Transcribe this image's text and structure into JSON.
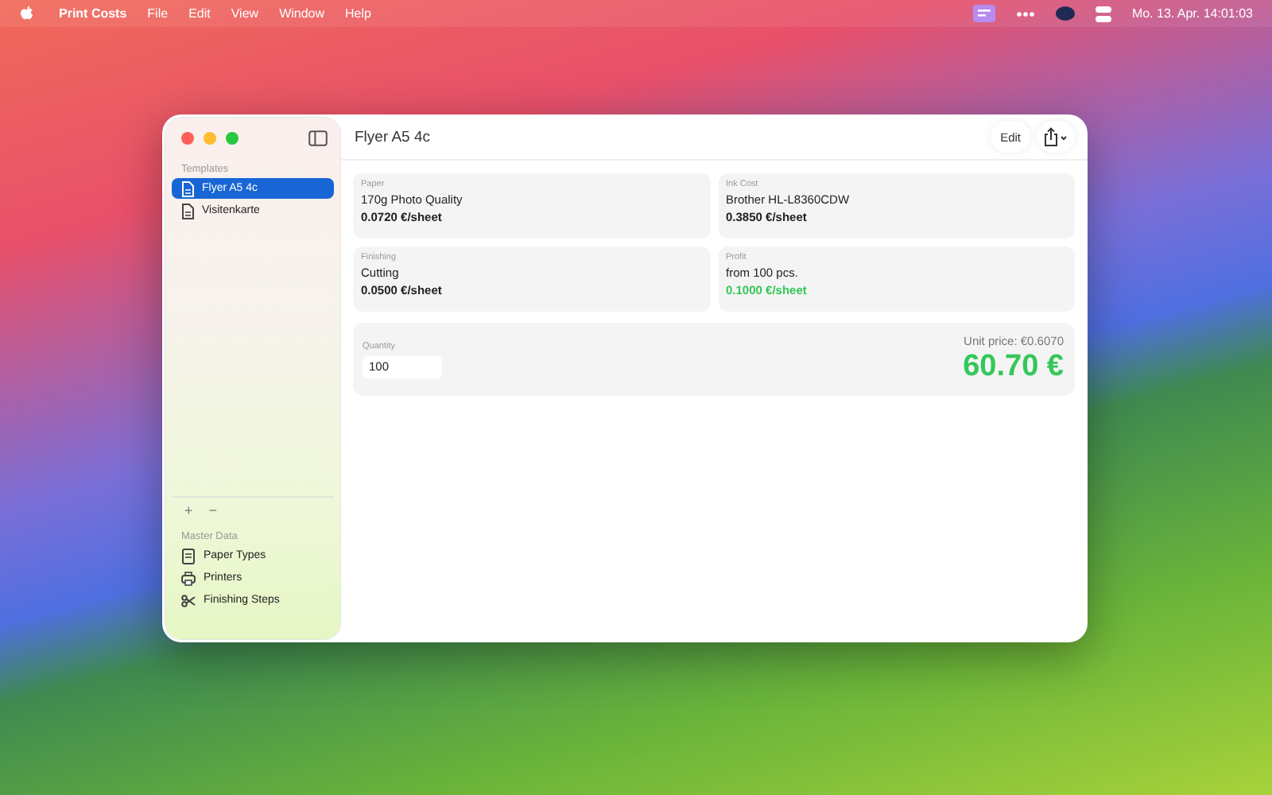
{
  "menu_bar": {
    "app_name": "Print Costs",
    "menus": [
      "File",
      "Edit",
      "View",
      "Window",
      "Help"
    ],
    "clock": "Mo. 13. Apr.  14:01:03"
  },
  "window": {
    "title": "Flyer A5 4c",
    "edit_button": "Edit"
  },
  "sidebar": {
    "templates_header": "Templates",
    "templates": [
      {
        "label": "Flyer A5 4c",
        "selected": true
      },
      {
        "label": "Visitenkarte",
        "selected": false
      }
    ],
    "add": "+",
    "remove": "−",
    "master_header": "Master Data",
    "master_items": [
      {
        "label": "Paper Types",
        "kind": "paper"
      },
      {
        "label": "Printers",
        "kind": "printer"
      },
      {
        "label": "Finishing Steps",
        "kind": "scissors"
      }
    ]
  },
  "cards": [
    {
      "label": "Paper",
      "name": "170g Photo Quality",
      "price": "0.0720 €/sheet",
      "kind": "cost"
    },
    {
      "label": "Ink Cost",
      "name": "Brother HL-L8360CDW",
      "price": "0.3850 €/sheet",
      "kind": "cost"
    },
    {
      "label": "Finishing",
      "name": "Cutting",
      "price": "0.0500 €/sheet",
      "kind": "cost"
    },
    {
      "label": "Profit",
      "name": "from 100 pcs.",
      "price": "0.1000 €/sheet",
      "kind": "profit"
    }
  ],
  "total": {
    "quantity_label": "Quantity",
    "quantity": "100",
    "unit_price": "Unit price: €0.6070",
    "total": "60.70 €"
  }
}
